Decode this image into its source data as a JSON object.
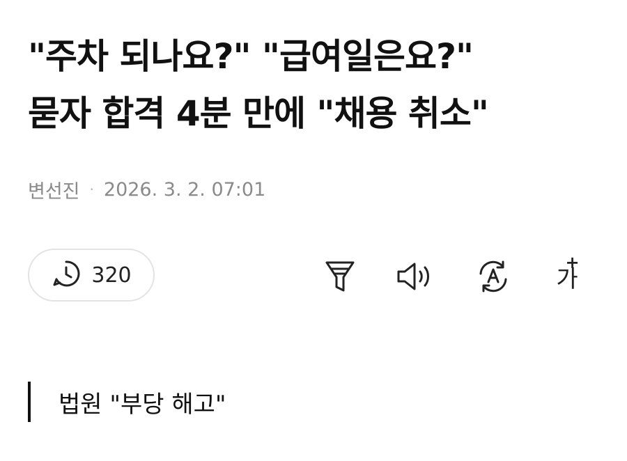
{
  "article": {
    "headline_line1": "\"주차 되나요?\" \"급여일은요?\"",
    "headline_line2": "묻자 합격 4분 만에 \"채용 취소\"",
    "author": "변선진",
    "separator": "·",
    "datetime": "2026. 3. 2. 07:01",
    "subheading": "법원 \"부당 해고\""
  },
  "toolbar": {
    "view_count": "320",
    "view_icon": "clock-icon",
    "font_size_label": "가",
    "font_size_plus": "+",
    "icons": [
      "filter-icon",
      "speaker-icon",
      "translate-icon",
      "font-size-icon"
    ]
  },
  "colors": {
    "text": "#111111",
    "meta": "#8a8a8a",
    "pill_border": "#e3e3e3",
    "icon": "#222222"
  }
}
